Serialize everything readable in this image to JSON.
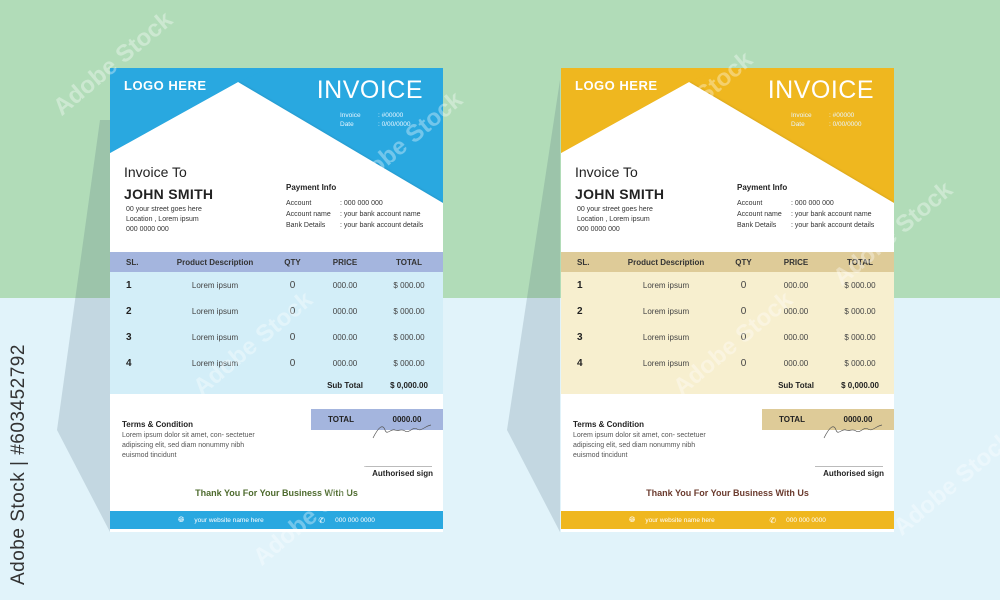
{
  "watermark": {
    "vertical_label": "Adobe Stock | #603452792",
    "diagonal_text": "Adobe Stock"
  },
  "invoices": [
    {
      "theme": "blue",
      "colors": {
        "accent": "#29a8e0",
        "table_header": "#a4b5de",
        "table_body": "#d3eef8",
        "total_box": "#a4b5de",
        "thanks": "#4e6b2e"
      },
      "logo": "LOGO HERE",
      "title": "INVOICE",
      "meta": [
        {
          "label": "Invoice",
          "value": ": #00000"
        },
        {
          "label": "Date",
          "value": ": 0/00/0000"
        }
      ],
      "invoice_to_label": "Invoice To",
      "client_name": "JOHN SMITH",
      "address": [
        "00 your street goes here",
        "Location , Lorem ipsum",
        "000 0000 000"
      ],
      "payment_title": "Payment Info",
      "payment_rows": [
        {
          "label": "Account",
          "value": ": 000 000 000"
        },
        {
          "label": "Account name",
          "value": ": your bank account name"
        },
        {
          "label": "Bank Details",
          "value": ": your bank account details"
        }
      ],
      "table": {
        "headers": [
          "SL.",
          "Product Description",
          "QTY",
          "PRICE",
          "TOTAL"
        ],
        "rows": [
          [
            "1",
            "Lorem ipsum",
            "0",
            "000.00",
            "$  000.00"
          ],
          [
            "2",
            "Lorem ipsum",
            "0",
            "000.00",
            "$  000.00"
          ],
          [
            "3",
            "Lorem ipsum",
            "0",
            "000.00",
            "$  000.00"
          ],
          [
            "4",
            "Lorem ipsum",
            "0",
            "000.00",
            "$  000.00"
          ]
        ],
        "subtotal_label": "Sub Total",
        "subtotal_value": "$ 0,000.00"
      },
      "total_label": "TOTAL",
      "total_value": "0000.00",
      "terms_title": "Terms & Condition",
      "terms_text": "Lorem ipsum dolor sit amet, con- sectetuer adipiscing elit, sed diam nonummy nibh euismod tincidunt",
      "signature": "john smith",
      "authorised_label": "Authorised sign",
      "thanks": "Thank You For Your Business With Us",
      "footer": {
        "website_icon": "globe-icon",
        "website": "your website name here",
        "phone_icon": "phone-icon",
        "phone": "000 000 0000"
      }
    },
    {
      "theme": "yellow",
      "colors": {
        "accent": "#efb71f",
        "table_header": "#decb98",
        "table_body": "#f7efcf",
        "total_box": "#decb98",
        "thanks": "#6b3b2e"
      },
      "logo": "LOGO HERE",
      "title": "INVOICE",
      "meta": [
        {
          "label": "Invoice",
          "value": ": #00000"
        },
        {
          "label": "Date",
          "value": ": 0/00/0000"
        }
      ],
      "invoice_to_label": "Invoice To",
      "client_name": "JOHN SMITH",
      "address": [
        "00 your street goes here",
        "Location , Lorem ipsum",
        "000 0000 000"
      ],
      "payment_title": "Payment Info",
      "payment_rows": [
        {
          "label": "Account",
          "value": ": 000 000 000"
        },
        {
          "label": "Account name",
          "value": ": your bank account name"
        },
        {
          "label": "Bank Details",
          "value": ": your bank account details"
        }
      ],
      "table": {
        "headers": [
          "SL.",
          "Product Description",
          "QTY",
          "PRICE",
          "TOTAL"
        ],
        "rows": [
          [
            "1",
            "Lorem ipsum",
            "0",
            "000.00",
            "$  000.00"
          ],
          [
            "2",
            "Lorem ipsum",
            "0",
            "000.00",
            "$  000.00"
          ],
          [
            "3",
            "Lorem ipsum",
            "0",
            "000.00",
            "$  000.00"
          ],
          [
            "4",
            "Lorem ipsum",
            "0",
            "000.00",
            "$  000.00"
          ]
        ],
        "subtotal_label": "Sub Total",
        "subtotal_value": "$ 0,000.00"
      },
      "total_label": "TOTAL",
      "total_value": "0000.00",
      "terms_title": "Terms & Condition",
      "terms_text": "Lorem ipsum dolor sit amet, con- sectetuer adipiscing elit, sed diam nonummy nibh euismod tincidunt",
      "signature": "john smith",
      "authorised_label": "Authorised sign",
      "thanks": "Thank You For Your Business With Us",
      "footer": {
        "website_icon": "globe-icon",
        "website": "your website name here",
        "phone_icon": "phone-icon",
        "phone": "000 000 0000"
      }
    }
  ]
}
